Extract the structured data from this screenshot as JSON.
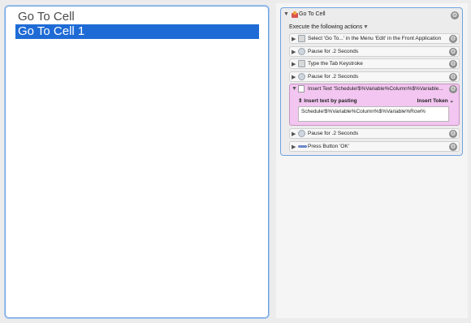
{
  "list": {
    "items": [
      "Go To Cell",
      "Go To Cell 1"
    ]
  },
  "macro": {
    "title": "Go To Cell",
    "execute_label": "Execute the following actions",
    "actions": [
      "Select 'Go To...' in the Menu 'Edit' in the Front Application",
      "Pause for .2 Seconds",
      "Type the Tab Keystroke",
      "Pause for .2 Seconds",
      "Insert Text 'Schedule!$%Variable%Column%$%Variable...",
      "Pause for .2 Seconds",
      "Press Button 'OK'"
    ],
    "insert": {
      "mode_label": "Insert text by pasting",
      "token_label": "Insert Token",
      "text_value": "Schedule!$%Variable%Column%$%Variable%Row%"
    }
  },
  "icons": {
    "expand": "disclosure-triangle-icon",
    "gear": "gear-icon",
    "pause": "clock-icon",
    "menu": "menu-icon",
    "keystroke": "keyboard-icon",
    "text": "text-document-icon",
    "button": "button-icon",
    "macro": "keyboard-maestro-icon"
  },
  "colors": {
    "selection": "#1e6bd6",
    "insert_highlight": "#f2c6f0",
    "focus_border": "#6fa3e0"
  }
}
